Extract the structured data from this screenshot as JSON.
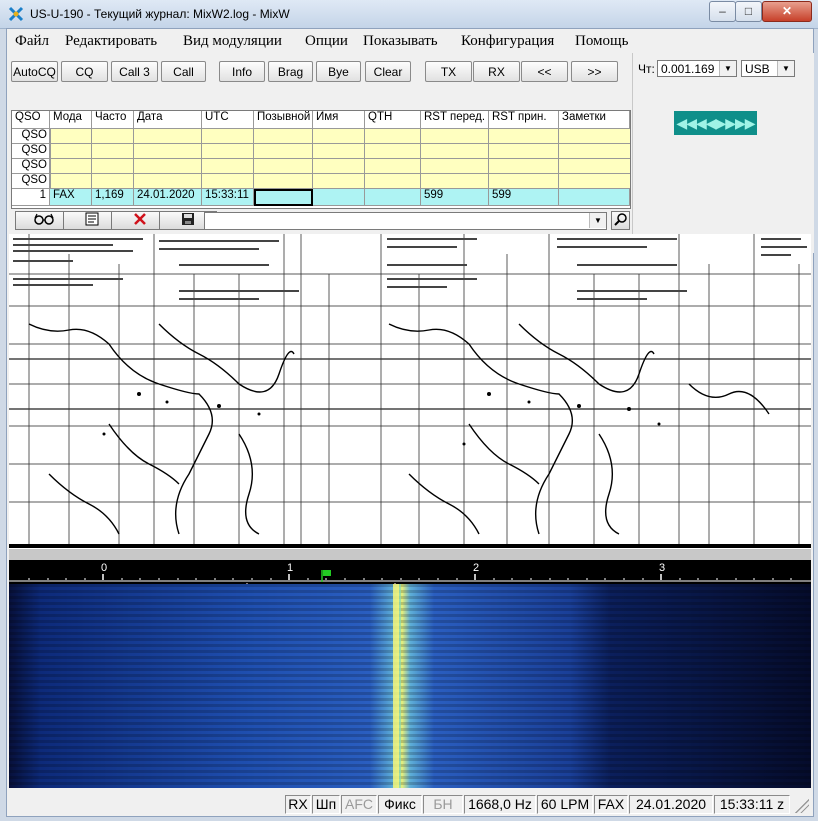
{
  "window": {
    "title": "US-U-190 - Текущий журнал: MixW2.log - MixW",
    "controls": {
      "minimize": "–",
      "maximize": "□",
      "close": "✕"
    }
  },
  "menu": [
    "Файл",
    "Редактировать",
    "Вид модуляции",
    "Опции",
    "Показывать",
    "Конфигурация",
    "Помощь"
  ],
  "toolbar": [
    "AutoCQ",
    "CQ",
    "Call 3",
    "Call",
    "Info",
    "Brag",
    "Bye",
    "Clear",
    "TX",
    "RX",
    "<<",
    ">>"
  ],
  "frequency": {
    "label": "Чт:",
    "value": "0.001.169",
    "mode": "USB",
    "tuner_arrows": "◀◀◀◀▶▶▶▶"
  },
  "log_table": {
    "headers": [
      "QSO",
      "Мода",
      "Частота, кГц",
      "Дата",
      "UTC",
      "Позывной",
      "Имя",
      "QTH",
      "RST перед.",
      "RST прин.",
      "Заметки"
    ],
    "header_display": [
      "QSO",
      "Мода",
      "Часто",
      "Дата",
      "UTC",
      "Позывной",
      "Имя",
      "QTH",
      "RST перед.",
      "RST прин.",
      "Заметки"
    ],
    "history_rows": [
      "QSO",
      "QSO",
      "QSO",
      "QSO"
    ],
    "current": {
      "num": "1",
      "mode": "FAX",
      "freq": "1,169",
      "date": "24.01.2020",
      "utc": "15:33:11",
      "call": "",
      "name": "",
      "qth": "",
      "rst_sent": "599",
      "rst_rcvd": "599",
      "notes": ""
    }
  },
  "log_tools": {
    "icons": [
      "glasses-icon",
      "notepad-icon",
      "delete-icon",
      "save-icon"
    ],
    "search_value": ""
  },
  "fax": {
    "description": "received weather fax map"
  },
  "waterfall": {
    "scale_labels": [
      "0",
      "1",
      "2",
      "3"
    ],
    "scale_unit": "kHz",
    "signal_khz": 1.668
  },
  "status": {
    "rx": "RX",
    "squelch": "Шп",
    "afc": "AFC",
    "fix": "Фикс",
    "bn": "БН",
    "freq": "1668,0 Hz",
    "lpm": "60 LPM",
    "mode": "FAX",
    "date": "24.01.2020",
    "time": "15:33:11 z"
  },
  "colors": {
    "log_header": "#ffffff",
    "log_history": "#ffffc0",
    "log_current": "#aef3f3",
    "tuner": "#0f8f8a"
  }
}
